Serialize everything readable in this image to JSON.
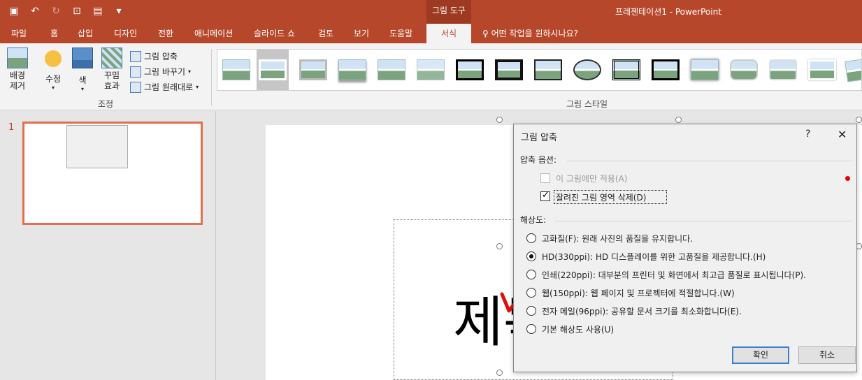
{
  "titlebar": {
    "context_tab": "그림 도구",
    "document_title": "프레젠테이션1  -  PowerPoint"
  },
  "tabs": [
    "파일",
    "홈",
    "삽입",
    "디자인",
    "전환",
    "애니메이션",
    "슬라이드 쇼",
    "검토",
    "보기",
    "도움말",
    "서식"
  ],
  "tell_me": "어떤 작업을 원하시나요?",
  "ribbon": {
    "remove_bg": "배경\n제거",
    "corrections": "수정",
    "color": "색",
    "artistic_effects": "꾸밈\n효과",
    "compress": "그림 압축",
    "change": "그림 바꾸기",
    "reset": "그림 원래대로",
    "adjust_group": "조정",
    "styles_group": "그림 스타일"
  },
  "slides": {
    "number": "1"
  },
  "slide": {
    "title_text": "제목"
  },
  "dialog": {
    "title": "그림 압축",
    "help": "?",
    "close": "✕",
    "compress_options_label": "압축 옵션:",
    "apply_only": "이 그림에만 적용(A)",
    "delete_cropped": "잘려진 그림 영역 삭제(D)",
    "resolution_label": "해상도:",
    "resolutions": [
      "고화질(F): 원래 사진의 품질을 유지합니다.",
      "HD(330ppi): HD 디스플레이를 위한 고품질을 제공합니다.(H)",
      "인쇄(220ppi): 대부분의 프린터 및 화면에서 최고급 품질로 표시됩니다(P).",
      "웹(150ppi): 웹 페이지 및 프로젝터에 적절합니다.(W)",
      "전자 메일(96ppi): 공유할 문서 크기를 최소화합니다(E).",
      "기본 해상도 사용(U)"
    ],
    "selected_resolution_index": 1,
    "ok": "확인",
    "cancel": "취소"
  },
  "colors": {
    "accent": "#b7472a",
    "thumb_border": "#e2704e"
  }
}
